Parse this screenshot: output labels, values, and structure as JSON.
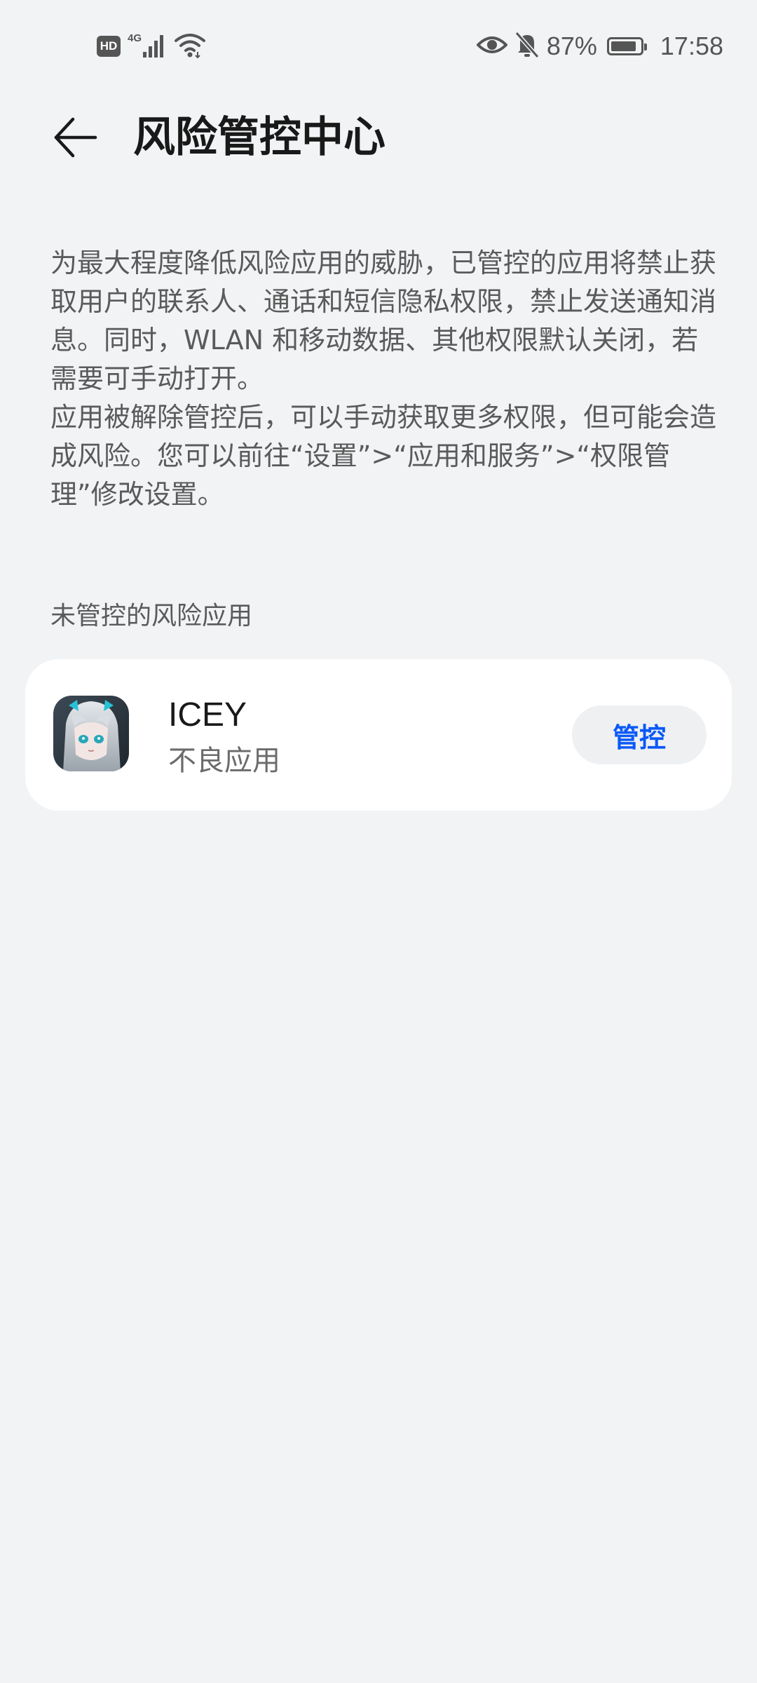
{
  "status_bar": {
    "hd_label": "HD",
    "network_label": "4G",
    "battery_text": "87%",
    "battery_level": 0.87,
    "time": "17:58",
    "icons": [
      "hd-icon",
      "signal-icon",
      "wifi-icon",
      "eye-icon",
      "bell-muted-icon",
      "battery-icon"
    ]
  },
  "header": {
    "title": "风险管控中心",
    "back_icon": "arrow-left-icon"
  },
  "description": {
    "paragraph1": "为最大程度降低风险应用的威胁，已管控的应用将禁止获取用户的联系人、通话和短信隐私权限，禁止发送通知消息。同时，WLAN 和移动数据、其他权限默认关闭，若需要可手动打开。",
    "paragraph2": "应用被解除管控后，可以手动获取更多权限，但可能会造成风险。您可以前往“设置”>“应用和服务”>“权限管理”修改设置。"
  },
  "section": {
    "label": "未管控的风险应用"
  },
  "apps": [
    {
      "name": "ICEY",
      "subtitle": "不良应用",
      "action_label": "管控",
      "icon": "icey-app-icon"
    }
  ],
  "colors": {
    "background": "#f1f3f5",
    "card": "#ffffff",
    "accent": "#0a59f7",
    "button_bg": "#eef0f2"
  }
}
